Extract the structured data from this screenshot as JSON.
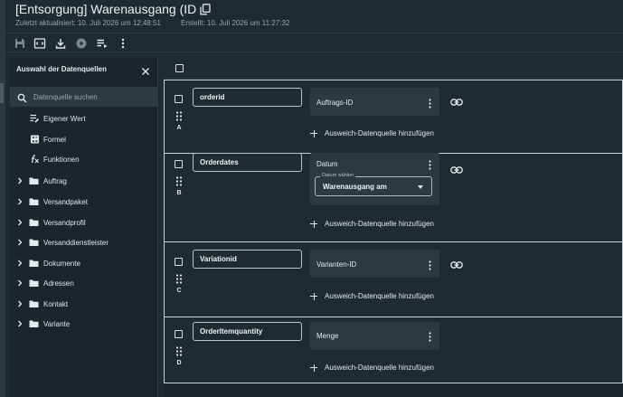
{
  "header": {
    "title": "[Entsorgung] Warenausgang (ID",
    "updated": "Zuletzt aktualisiert: 10. Juli 2026 um 12:48:51",
    "created": "Erstellt: 10. Juli 2026 um 11:27:32"
  },
  "toolbar": {
    "icons": [
      "save-icon",
      "code-icon",
      "download-icon",
      "play-icon",
      "playlist-icon",
      "more-vertical-icon"
    ]
  },
  "sidebar": {
    "title": "Auswahl der Datenquellen",
    "search_placeholder": "Datenquelle suchen",
    "tools": [
      {
        "label": "Eigener Wert",
        "icon": "edit-list-icon"
      },
      {
        "label": "Formel",
        "icon": "calculator-icon"
      },
      {
        "label": "Funktionen",
        "icon": "function-icon"
      }
    ],
    "folders": [
      {
        "label": "Auftrag"
      },
      {
        "label": "Versandpaket"
      },
      {
        "label": "Versandprofil"
      },
      {
        "label": "Versanddienstleister"
      },
      {
        "label": "Dokumente"
      },
      {
        "label": "Adressen"
      },
      {
        "label": "Kontakt"
      },
      {
        "label": "Variante"
      }
    ]
  },
  "rows": [
    {
      "letter": "A",
      "name": "orderid",
      "source": "Auftrags-ID",
      "add_label": "Ausweich-Datenquelle hinzufügen"
    },
    {
      "letter": "B",
      "name": "Orderdates",
      "source": "Datum",
      "date_legend": "Datum wählen",
      "date_value": "Warenausgang am",
      "add_label": "Ausweich-Datenquelle hinzufügen"
    },
    {
      "letter": "C",
      "name": "Variationid",
      "source": "Varianten-ID",
      "add_label": "Ausweich-Datenquelle hinzufügen"
    },
    {
      "letter": "D",
      "name": "OrderItemquantity",
      "source": "Menge",
      "add_label": "Ausweich-Datenquelle hinzufügen"
    }
  ]
}
